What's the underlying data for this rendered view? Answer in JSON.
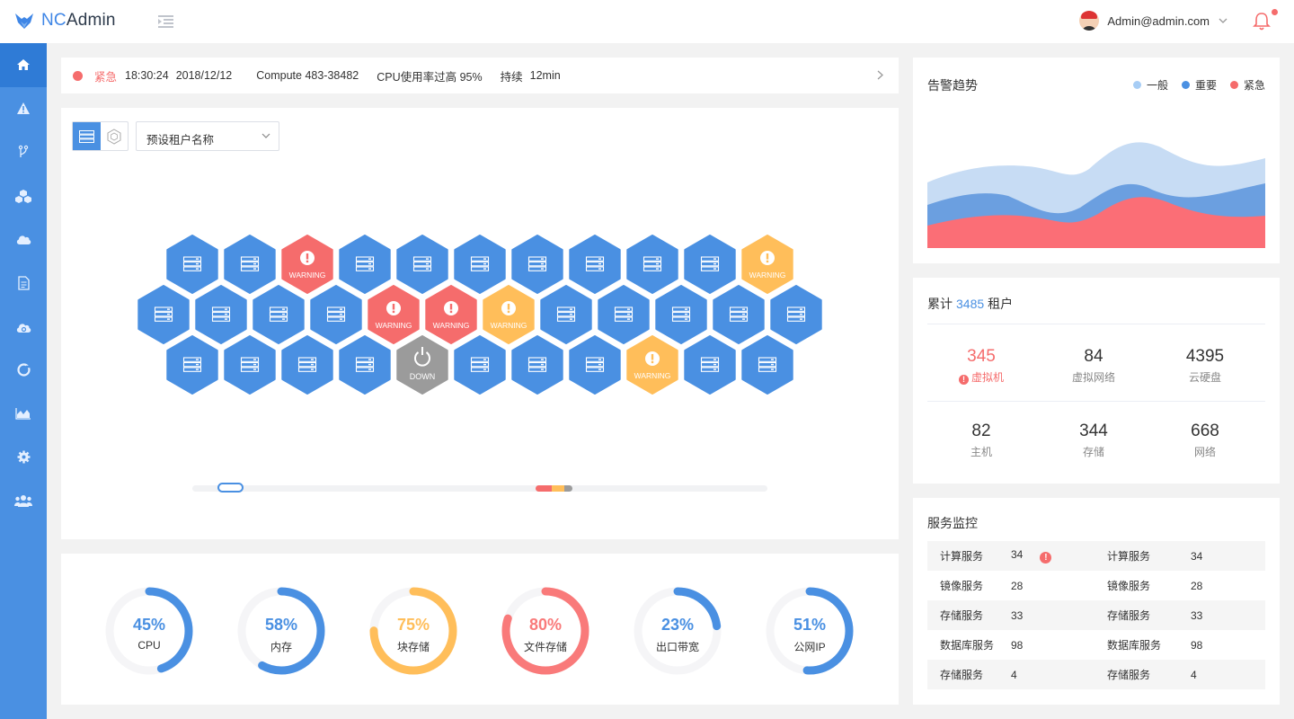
{
  "app": {
    "logo_prefix": "NC",
    "logo_suffix": "Admin",
    "user": "Admin@admin.com"
  },
  "sidebar": {
    "items": [
      {
        "icon": "home-icon",
        "active": true
      },
      {
        "icon": "warning-icon"
      },
      {
        "icon": "branch-icon"
      },
      {
        "icon": "cubes-icon"
      },
      {
        "icon": "cloud-icon"
      },
      {
        "icon": "document-icon"
      },
      {
        "icon": "cloud-sync-icon"
      },
      {
        "icon": "refresh-icon"
      },
      {
        "icon": "area-chart-icon"
      },
      {
        "icon": "gear-icon"
      },
      {
        "icon": "users-icon"
      }
    ]
  },
  "alert": {
    "level": "紧急",
    "time": "18:30:24",
    "date": "2018/12/12",
    "host": "Compute 483-38482",
    "message": "CPU使用率过高 95%",
    "duration_label": "持续",
    "duration": "12min"
  },
  "map": {
    "tenant_placeholder": "预设租户名称",
    "rows": [
      [
        "ok",
        "ok",
        "warning-red",
        "ok",
        "ok",
        "ok",
        "ok",
        "ok",
        "ok",
        "ok",
        "warning-orange"
      ],
      [
        "ok",
        "ok",
        "ok",
        "ok",
        "warning-red",
        "warning-red",
        "warning-orange",
        "ok",
        "ok",
        "ok",
        "ok",
        "ok"
      ],
      [
        "ok",
        "ok",
        "ok",
        "ok",
        "down",
        "ok",
        "ok",
        "ok",
        "warning-orange",
        "ok",
        "ok"
      ]
    ],
    "warning_label": "WARNING",
    "down_label": "DOWN"
  },
  "gauges": [
    {
      "value": "45%",
      "percent": 45,
      "label": "CPU",
      "color": "#4a90e2"
    },
    {
      "value": "58%",
      "percent": 58,
      "label": "内存",
      "color": "#4a90e2"
    },
    {
      "value": "75%",
      "percent": 75,
      "label": "块存储",
      "color": "#ffbe5a"
    },
    {
      "value": "80%",
      "percent": 80,
      "label": "文件存储",
      "color": "#f97a7a"
    },
    {
      "value": "23%",
      "percent": 23,
      "label": "出口带宽",
      "color": "#4a90e2"
    },
    {
      "value": "51%",
      "percent": 51,
      "label": "公网IP",
      "color": "#4a90e2"
    }
  ],
  "trend": {
    "title": "告警趋势",
    "legend": [
      {
        "name": "一般",
        "color": "#a7cdf5"
      },
      {
        "name": "重要",
        "color": "#4a90e2"
      },
      {
        "name": "紧急",
        "color": "#f56c6c"
      }
    ]
  },
  "tenants": {
    "prefix": "累计",
    "count": "3485",
    "suffix": "租户",
    "stats": [
      {
        "value": "345",
        "label": "虚拟机",
        "alarm": true
      },
      {
        "value": "84",
        "label": "虚拟网络"
      },
      {
        "value": "4395",
        "label": "云硬盘"
      },
      {
        "value": "82",
        "label": "主机"
      },
      {
        "value": "344",
        "label": "存储"
      },
      {
        "value": "668",
        "label": "网络"
      }
    ]
  },
  "services": {
    "title": "服务监控",
    "rows": [
      {
        "n1": "计算服务",
        "v1": "34",
        "alarm": true,
        "n2": "计算服务",
        "v2": "34"
      },
      {
        "n1": "镜像服务",
        "v1": "28",
        "n2": "镜像服务",
        "v2": "28"
      },
      {
        "n1": "存储服务",
        "v1": "33",
        "n2": "存储服务",
        "v2": "33"
      },
      {
        "n1": "数据库服务",
        "v1": "98",
        "n2": "数据库服务",
        "v2": "98"
      },
      {
        "n1": "存储服务",
        "v1": "4",
        "n2": "存储服务",
        "v2": "4"
      }
    ],
    "alarm_symbol": "!"
  },
  "colors": {
    "primary": "#4a90e2",
    "danger": "#f56c6c",
    "warning": "#ffbe5a",
    "down": "#9b9b9b"
  }
}
